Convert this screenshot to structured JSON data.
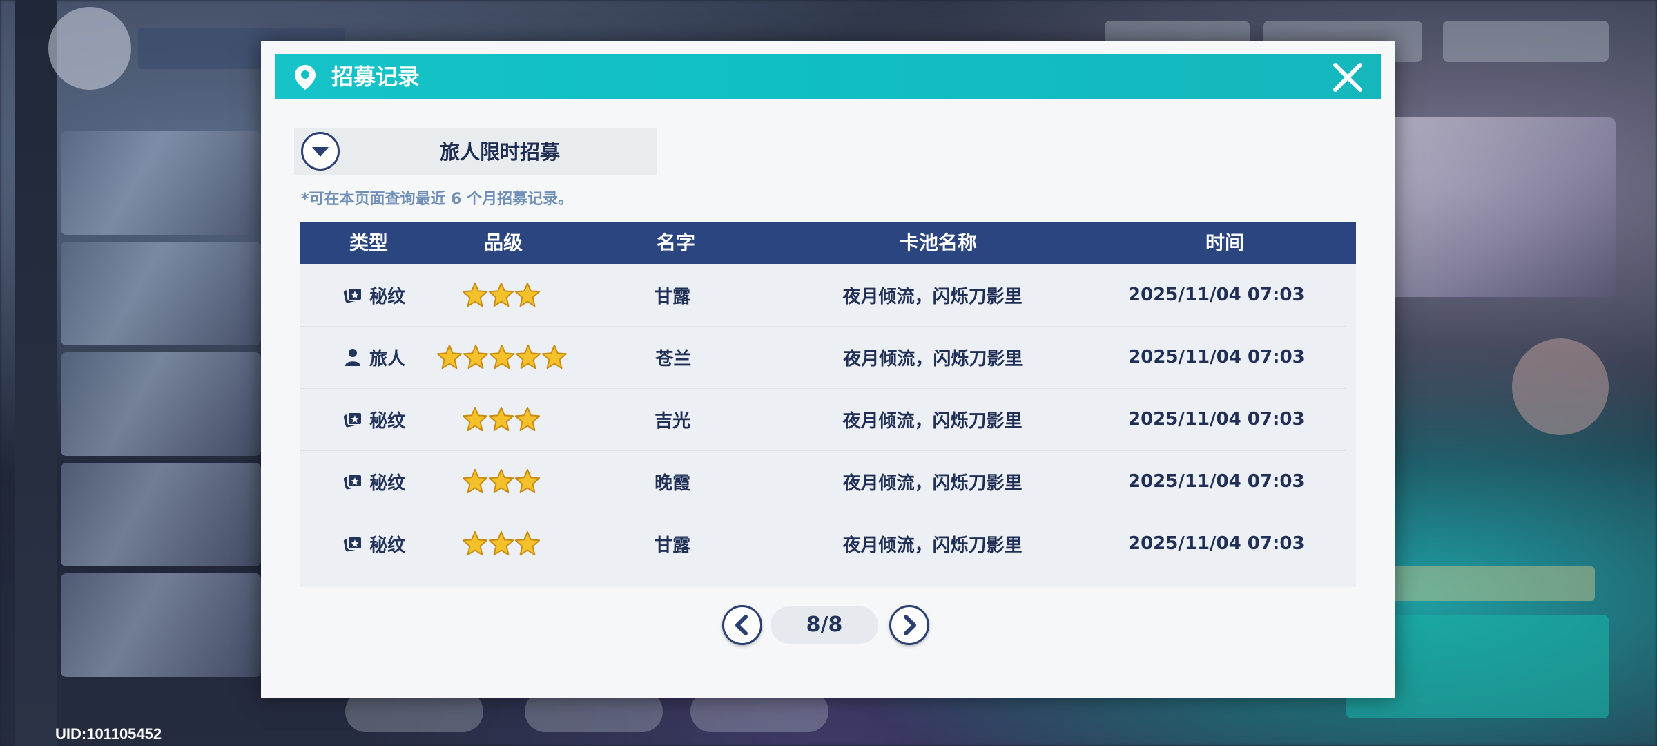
{
  "uid": "UID:101105452",
  "dialog": {
    "title": "招募记录",
    "pool_selector": "旅人限时招募",
    "note": "*可在本页面查询最近 6 个月招募记录。"
  },
  "table": {
    "headers": {
      "type": "类型",
      "rank": "品级",
      "name": "名字",
      "pool": "卡池名称",
      "time": "时间"
    },
    "rows": [
      {
        "type": "秘纹",
        "type_icon": "card-icon",
        "stars": 3,
        "name": "甘露",
        "pool": "夜月倾流，闪烁刀影里",
        "time": "2025/11/04 07:03"
      },
      {
        "type": "旅人",
        "type_icon": "person-icon",
        "stars": 5,
        "name": "苍兰",
        "pool": "夜月倾流，闪烁刀影里",
        "time": "2025/11/04 07:03"
      },
      {
        "type": "秘纹",
        "type_icon": "card-icon",
        "stars": 3,
        "name": "吉光",
        "pool": "夜月倾流，闪烁刀影里",
        "time": "2025/11/04 07:03"
      },
      {
        "type": "秘纹",
        "type_icon": "card-icon",
        "stars": 3,
        "name": "晚霞",
        "pool": "夜月倾流，闪烁刀影里",
        "time": "2025/11/04 07:03"
      },
      {
        "type": "秘纹",
        "type_icon": "card-icon",
        "stars": 3,
        "name": "甘露",
        "pool": "夜月倾流，闪烁刀影里",
        "time": "2025/11/04 07:03"
      }
    ]
  },
  "pagination": {
    "page": "8/8"
  },
  "colors": {
    "header_teal": "#16c3c8",
    "table_header_navy": "#2a4580",
    "text_navy": "#22335c",
    "star_gold": "#f5c12b"
  }
}
